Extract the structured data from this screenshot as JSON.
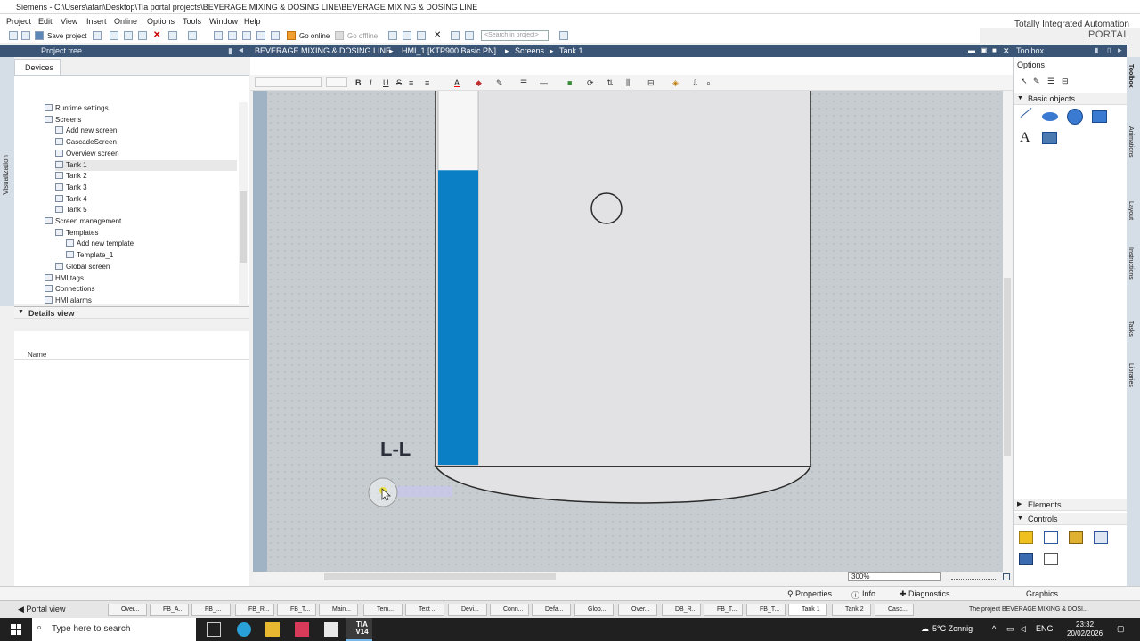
{
  "window": {
    "title": "Siemens  -  C:\\Users\\afari\\Desktop\\Tia portal projects\\BEVERAGE MIXING & DOSING LINE\\BEVERAGE MIXING & DOSING LINE",
    "brand_line1": "Totally Integrated Automation",
    "brand_line2": "PORTAL"
  },
  "menu": [
    "Project",
    "Edit",
    "View",
    "Insert",
    "Online",
    "Options",
    "Tools",
    "Window",
    "Help"
  ],
  "toolbar": {
    "save_label": "Save project",
    "go_online": "Go online",
    "go_offline": "Go offline",
    "search_placeholder": "<Search in project>"
  },
  "project_tree": {
    "header": "Project tree",
    "side_label": "Visualization",
    "tab": "Devices",
    "items": [
      {
        "label": "Runtime settings",
        "indent": 0
      },
      {
        "label": "Screens",
        "indent": 0
      },
      {
        "label": "Add new screen",
        "indent": 1
      },
      {
        "label": "CascadeScreen",
        "indent": 1
      },
      {
        "label": "Overview screen",
        "indent": 1
      },
      {
        "label": "Tank 1",
        "indent": 1
      },
      {
        "label": "Tank 2",
        "indent": 1
      },
      {
        "label": "Tank 3",
        "indent": 1
      },
      {
        "label": "Tank 4",
        "indent": 1
      },
      {
        "label": "Tank 5",
        "indent": 1
      },
      {
        "label": "Screen management",
        "indent": 0
      },
      {
        "label": "Templates",
        "indent": 1
      },
      {
        "label": "Add new template",
        "indent": 2
      },
      {
        "label": "Template_1",
        "indent": 2
      },
      {
        "label": "Global screen",
        "indent": 1
      },
      {
        "label": "HMI tags",
        "indent": 0
      },
      {
        "label": "Connections",
        "indent": 0
      },
      {
        "label": "HMI alarms",
        "indent": 0
      }
    ],
    "selected": "Tank 1"
  },
  "details_view": {
    "header": "Details view",
    "column_name": "Name"
  },
  "editor": {
    "breadcrumb": [
      "BEVERAGE MIXING & DOSING LINE",
      "HMI_1 [KTP900 Basic PN]",
      "Screens",
      "Tank 1"
    ],
    "level_label": "L-L",
    "tank_fill_level": 0.78,
    "zoom": "300%",
    "colors": {
      "level_fill": "#0a7fc6",
      "tank_body": "#e2e2e4",
      "canvas": "#c6ccd0"
    }
  },
  "toolbox": {
    "header": "Toolbox",
    "options": "Options",
    "sections": [
      "Basic objects",
      "Elements",
      "Controls",
      "Graphics"
    ]
  },
  "side_tabs": [
    "Toolbox",
    "Animations",
    "Layout",
    "Instructions",
    "Tasks",
    "Libraries"
  ],
  "inspector": {
    "properties": "Properties",
    "info": "Info",
    "diagnostics": "Diagnostics"
  },
  "editor_tabs": {
    "portal_view": "Portal view",
    "tabs": [
      "Over...",
      "FB_A...",
      "FB_...",
      "FB_R...",
      "FB_T...",
      "Main...",
      "Tem...",
      "Text ...",
      "Devi...",
      "Conn...",
      "Defa...",
      "Glob...",
      "Over...",
      "DB_R...",
      "FB_T...",
      "FB_T...",
      "Tank 1",
      "Tank 2",
      "Casc..."
    ],
    "active": "Tank 1",
    "status": "The project BEVERAGE MIXING & DOSI..."
  },
  "taskbar": {
    "search": "Type here to search",
    "weather": "5°C  Zonnig",
    "lang": "ENG",
    "time": "23:32",
    "date": "20/02/2026",
    "app_label": "TIA V14"
  }
}
